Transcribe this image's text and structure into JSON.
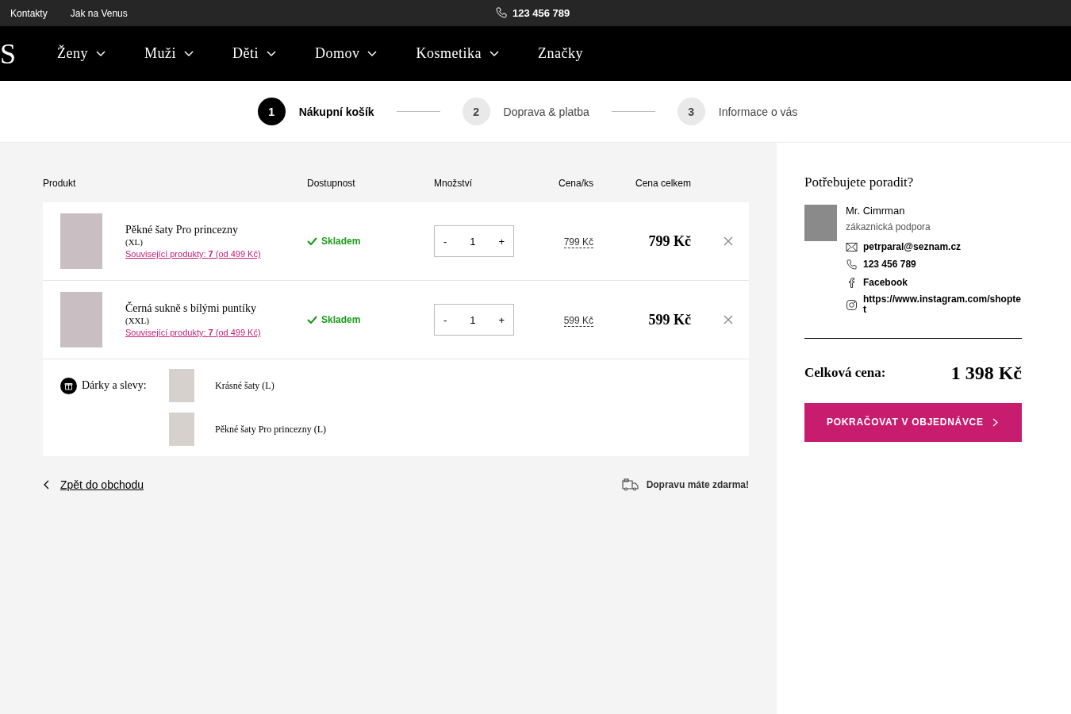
{
  "top_bar": {
    "links": [
      "Kontakty",
      "Jak na Venus"
    ],
    "phone": "123 456 789"
  },
  "nav": {
    "logo": "S",
    "items": [
      {
        "label": "Ženy",
        "dropdown": true
      },
      {
        "label": "Muži",
        "dropdown": true
      },
      {
        "label": "Děti",
        "dropdown": true
      },
      {
        "label": "Domov",
        "dropdown": true
      },
      {
        "label": "Kosmetika",
        "dropdown": true
      },
      {
        "label": "Značky",
        "dropdown": false
      }
    ]
  },
  "steps": [
    {
      "number": "1",
      "label": "Nákupní košík",
      "selected": true
    },
    {
      "number": "2",
      "label": "Doprava & platba",
      "selected": false
    },
    {
      "number": "3",
      "label": "Informace o vás",
      "selected": false
    }
  ],
  "cart": {
    "columns": [
      "Produkt",
      "Dostupnost",
      "Množství",
      "Cena/ks",
      "Cena celkem"
    ],
    "items": [
      {
        "name": "Pěkné šaty Pro princezny",
        "size": "(XL)",
        "related": "Související produkty: **7** (od 499 Kč)",
        "availability": "Skladem",
        "decrease": "-",
        "quantity": "1",
        "increase": "+",
        "unit_price": "799 Kč",
        "total_price": "799 Kč"
      },
      {
        "name": "Černá sukně s bílými puntíky",
        "size": "(XXL)",
        "related": "Související produkty: **7** (od 499 Kč)",
        "availability": "Skladem",
        "decrease": "-",
        "quantity": "1",
        "increase": "+",
        "unit_price": "599 Kč",
        "total_price": "599 Kč"
      }
    ],
    "gifts": {
      "label": "Dárky a slevy:",
      "items": [
        "Krásné šaty (L)",
        "Pěkné šaty Pro princezny (L)"
      ]
    }
  },
  "back_link": "Zpět do obchodu",
  "shipping_note": "Dopravu máte zdarma!",
  "help": {
    "title": "Potřebujete poradit?",
    "name": "Mr. Cimrman",
    "role": "zákaznická podpora",
    "contacts": [
      {
        "kind": "email",
        "text": "petrparal@seznam.cz"
      },
      {
        "kind": "phone",
        "text": "123 456 789"
      },
      {
        "kind": "facebook",
        "text": "Facebook"
      },
      {
        "kind": "instagram",
        "text": "https://www.instagram.com/shoptet"
      }
    ]
  },
  "total": {
    "label": "Celková cena:",
    "value": "1 398 Kč"
  },
  "checkout_button": "POKRAČOVAT V OBJEDNÁVCE"
}
